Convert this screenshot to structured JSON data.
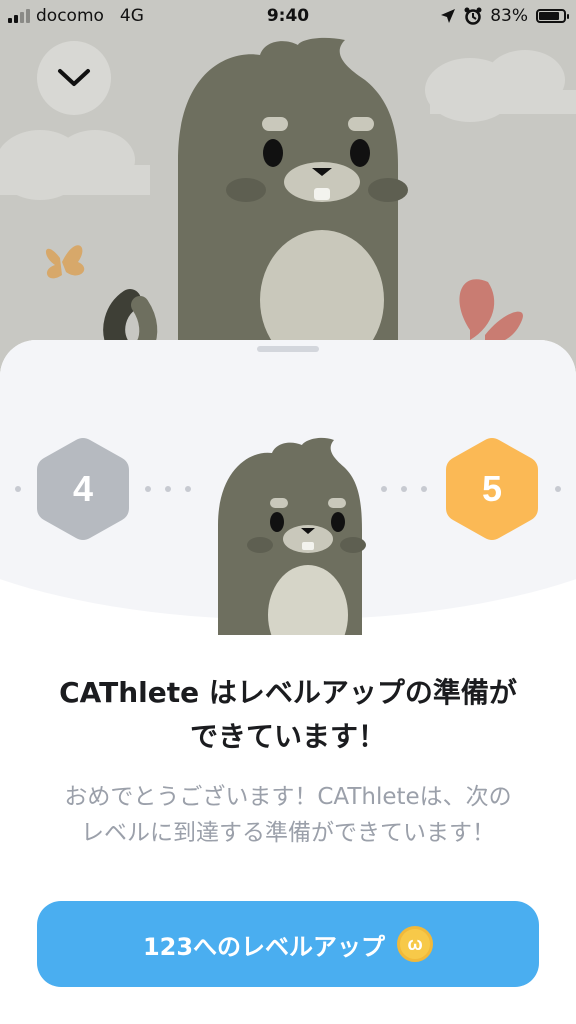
{
  "status_bar": {
    "carrier": "docomo",
    "network": "4G",
    "time": "9:40",
    "battery": "83%",
    "battery_level": 0.83,
    "icons": [
      "signal-icon",
      "location-arrow-icon",
      "alarm-icon",
      "battery-icon"
    ]
  },
  "header": {
    "collapse_icon": "chevron-down-icon",
    "illustration": "cat-character"
  },
  "levels": {
    "current": "4",
    "next": "5",
    "current_color": "#b6bac0",
    "next_color": "#fbb955"
  },
  "message": {
    "title_line1": "CAThlete はレベルアップの準備が",
    "title_line2": "できています！",
    "description_line1": "おめでとうございます！CAThleteは、次の",
    "description_line2": "レベルに到達する準備ができています！"
  },
  "action": {
    "level_up_label": "123へのレベルアップ",
    "coin_symbol": "ω",
    "button_color": "#4aaef0"
  }
}
